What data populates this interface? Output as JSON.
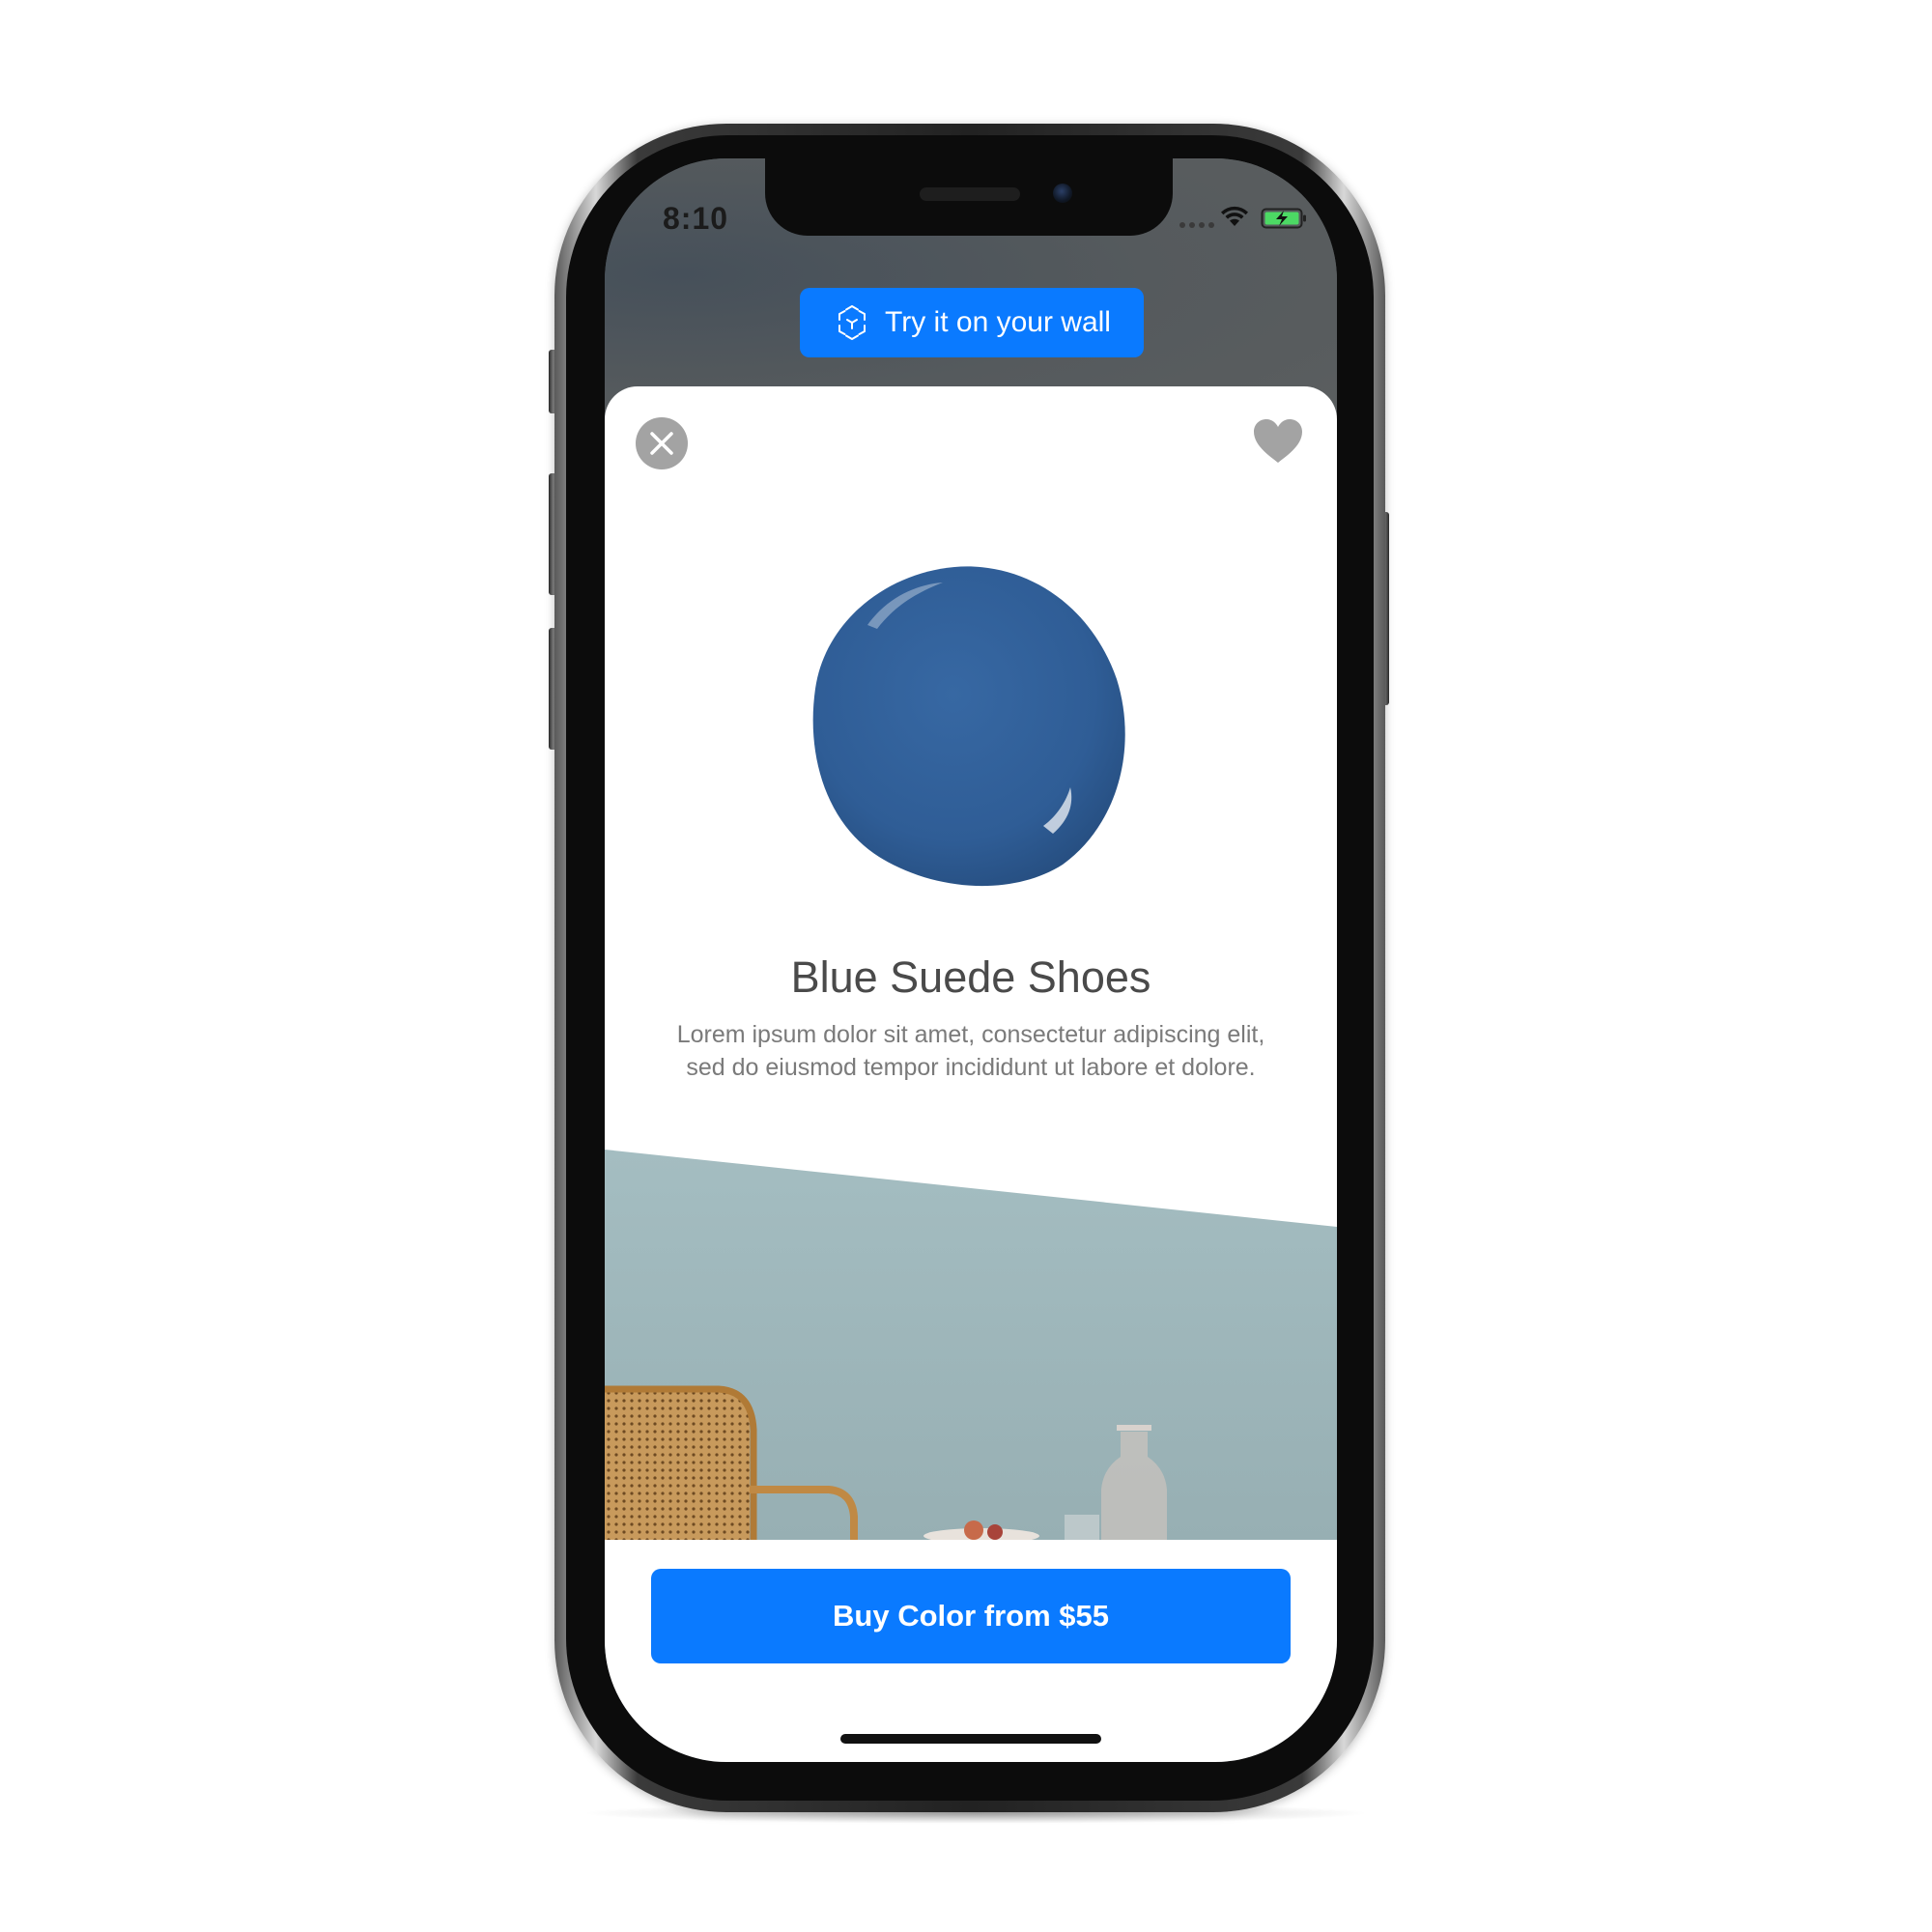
{
  "status_bar": {
    "time": "8:10"
  },
  "ar_button": {
    "label": "Try it on your wall",
    "icon": "ar-cube-icon"
  },
  "card": {
    "close_icon": "close-icon",
    "favorite_icon": "heart-icon",
    "swatch_color": "#2f5d96",
    "color_name": "Blue Suede Shoes",
    "description": "Lorem ipsum dolor sit amet, consectetur adipiscing elit, sed do eiusmod tempor incididunt ut labore et dolore."
  },
  "buy_button": {
    "label": "Buy Color from $55"
  },
  "colors": {
    "accent": "#0a7aff",
    "wall": "#9fb8bc",
    "icon_gray": "#a3a3a3"
  }
}
